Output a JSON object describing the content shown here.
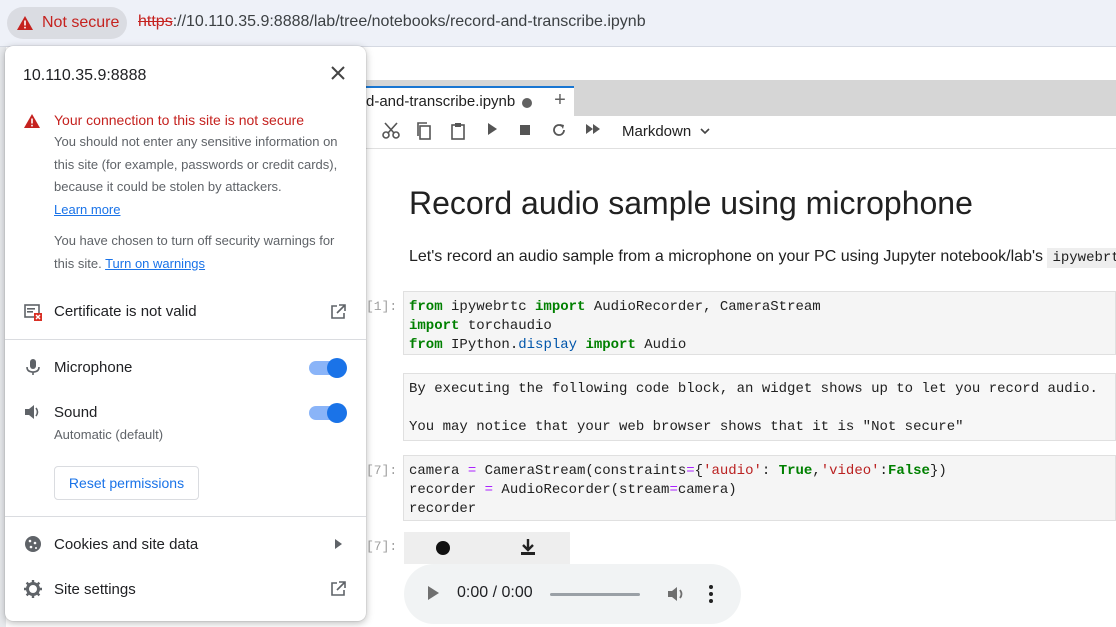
{
  "browser": {
    "security_chip": "Not secure",
    "url_scheme": "https",
    "url_rest": "://10.110.35.9:8888/lab/tree/notebooks/record-and-transcribe.ipynb"
  },
  "jupyter": {
    "tab_label": "d-and-transcribe.ipynb",
    "add_tab": "+",
    "cell_type": "Markdown",
    "heading": "Record audio sample using microphone",
    "intro_text": "Let's record an audio sample from a microphone on your PC using Jupyter notebook/lab's ",
    "intro_code": "ipywebrtc",
    "cells": {
      "c1_prompt": "[1]:",
      "c2_line1": "By executing the following code block, an widget shows up to let you record audio.",
      "c2_line2": "You may notice that your web browser shows that it is \"Not secure\"",
      "c3_prompt": "[7]:",
      "c4_prompt": "[7]:"
    },
    "audio_time": "0:00 / 0:00"
  },
  "popup": {
    "host": "10.110.35.9:8888",
    "warning_title": "Your connection to this site is not secure",
    "warning_body": "You should not enter any sensitive information on this site (for example, passwords or credit cards), because it could be stolen by attackers.",
    "learn_more": "Learn more",
    "turned_off_text": "You have chosen to turn off security warnings for this site.",
    "turn_on_warnings": "Turn on warnings",
    "certificate": "Certificate is not valid",
    "microphone": "Microphone",
    "sound": "Sound",
    "sound_sub": "Automatic (default)",
    "reset_permissions": "Reset permissions",
    "cookies": "Cookies and site data",
    "site_settings": "Site settings",
    "accent_color": "#1a73e8",
    "warning_color": "#c5221f"
  }
}
